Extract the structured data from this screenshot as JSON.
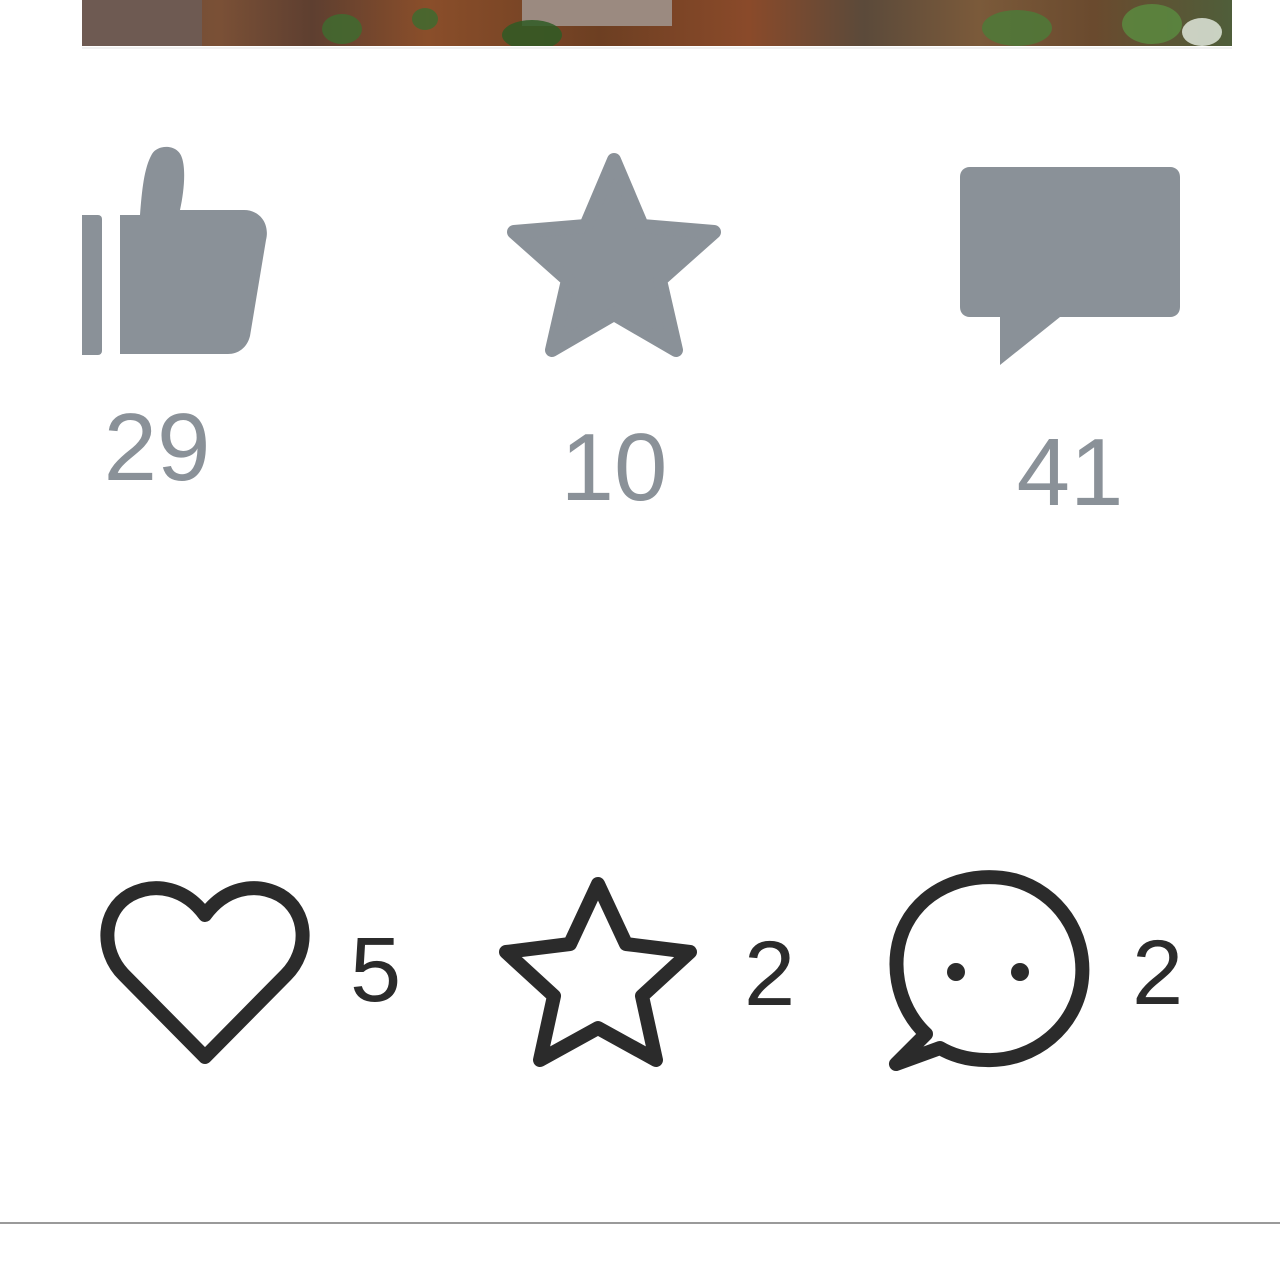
{
  "colors": {
    "stat_grey": "#8a9198",
    "action_dark": "#2b2b2b",
    "divider": "#9a9a9a"
  },
  "stats_top": [
    {
      "icon": "thumbs-up-icon",
      "count": "29"
    },
    {
      "icon": "star-filled-icon",
      "count": "10"
    },
    {
      "icon": "comment-filled-icon",
      "count": "41"
    }
  ],
  "action_bar": [
    {
      "icon": "heart-outline-icon",
      "count": "5"
    },
    {
      "icon": "star-outline-icon",
      "count": "2"
    },
    {
      "icon": "comment-bubble-outline-icon",
      "count": "2"
    }
  ]
}
